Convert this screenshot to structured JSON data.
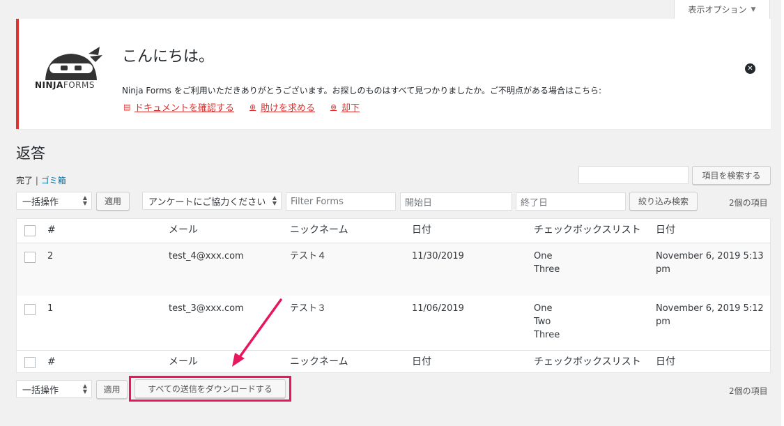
{
  "screen_options": {
    "label": "表示オプション"
  },
  "notice": {
    "logo_bold": "NINJA",
    "logo_light": "FORMS",
    "title": "こんにちは。",
    "body": "Ninja Forms をご利用いただきありがとうございます。お探しのものはすべて見つかりましたか。ご不明点がある場合はこちら:",
    "links": [
      {
        "label": "ドキュメントを確認する"
      },
      {
        "label": "助けを求める"
      },
      {
        "label": "却下"
      }
    ]
  },
  "page_title": "返答",
  "views": {
    "complete": "完了",
    "separator": "|",
    "trash": "ゴミ箱"
  },
  "search": {
    "button": "項目を検索する"
  },
  "filters": {
    "bulk_action": "一括操作",
    "apply": "適用",
    "form_select": "アンケートにご協力ください",
    "filter_forms_placeholder": "Filter Forms",
    "start_date_placeholder": "開始日",
    "end_date_placeholder": "終了日",
    "filter_button": "絞り込み検索",
    "count": "2個の項目"
  },
  "table": {
    "columns": [
      "#",
      "メール",
      "ニックネーム",
      "日付",
      "チェックボックスリスト",
      "日付"
    ],
    "rows": [
      {
        "num": "2",
        "email": "test_4@xxx.com",
        "nickname": "テスト４",
        "date": "11/30/2019",
        "checks": [
          "One",
          "Three"
        ],
        "submitted_1": "November 6, 2019 5:13",
        "submitted_2": "pm"
      },
      {
        "num": "1",
        "email": "test_3@xxx.com",
        "nickname": "テスト３",
        "date": "11/06/2019",
        "checks": [
          "One",
          "Two",
          "Three"
        ],
        "submitted_1": "November 6, 2019 5:12",
        "submitted_2": "pm"
      }
    ]
  },
  "bottom": {
    "bulk_action": "一括操作",
    "apply": "適用",
    "download": "すべての送信をダウンロードする",
    "count": "2個の項目"
  },
  "colors": {
    "accent_red": "#dc3232",
    "link_blue": "#0073aa",
    "highlight": "#e8175d"
  }
}
